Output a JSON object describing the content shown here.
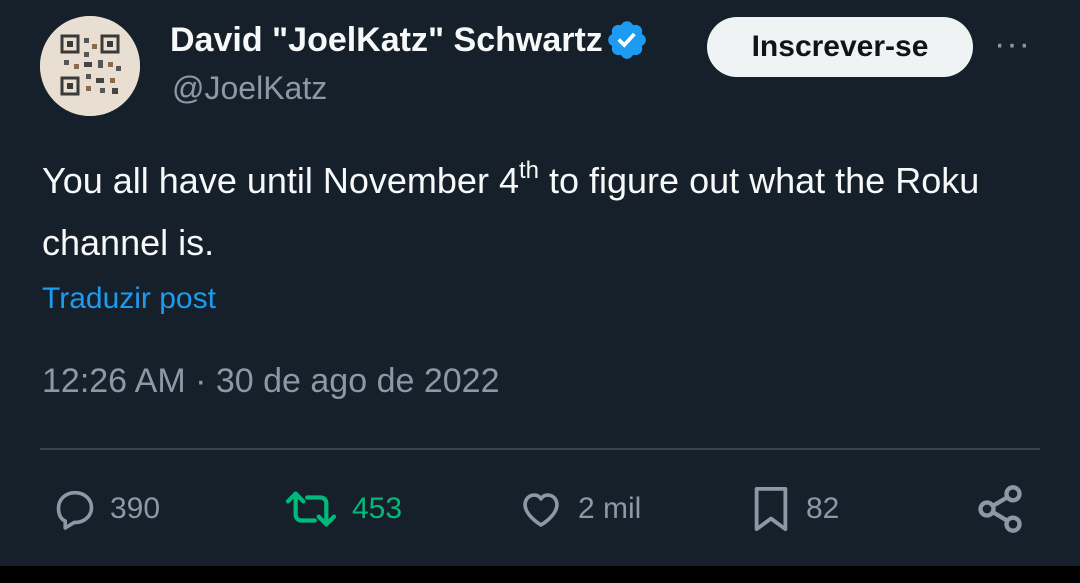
{
  "author": {
    "display_name": "David \"JoelKatz\" Schwartz",
    "handle": "@JoelKatz",
    "verified_icon": "verified-badge-icon",
    "avatar": "qr-code-avatar"
  },
  "follow_button": {
    "label": "Inscrever-se"
  },
  "more_menu": {
    "label": "···",
    "icon": "more-options-icon"
  },
  "tweet": {
    "text_before_sup": "You all have until November 4",
    "sup": "th",
    "text_after_sup": " to figure out what the Roku channel is.",
    "translate_link": "Traduzir post",
    "timestamp": "12:26 AM · 30 de ago de 2022"
  },
  "actions": {
    "reply": {
      "icon": "reply-icon",
      "count": "390"
    },
    "retweet": {
      "icon": "retweet-icon",
      "count": "453",
      "color": "#00ba7c"
    },
    "like": {
      "icon": "heart-icon",
      "count": "2 mil"
    },
    "bookmark": {
      "icon": "bookmark-icon",
      "count": "82"
    },
    "share": {
      "icon": "share-icon"
    }
  },
  "colors": {
    "background": "#15202b",
    "text": "#f7f9f9",
    "secondary_text": "#8b98a5",
    "link": "#1d9bf0",
    "verified": "#1d9bf0",
    "retweet_active": "#00ba7c",
    "divider": "#38444d"
  }
}
